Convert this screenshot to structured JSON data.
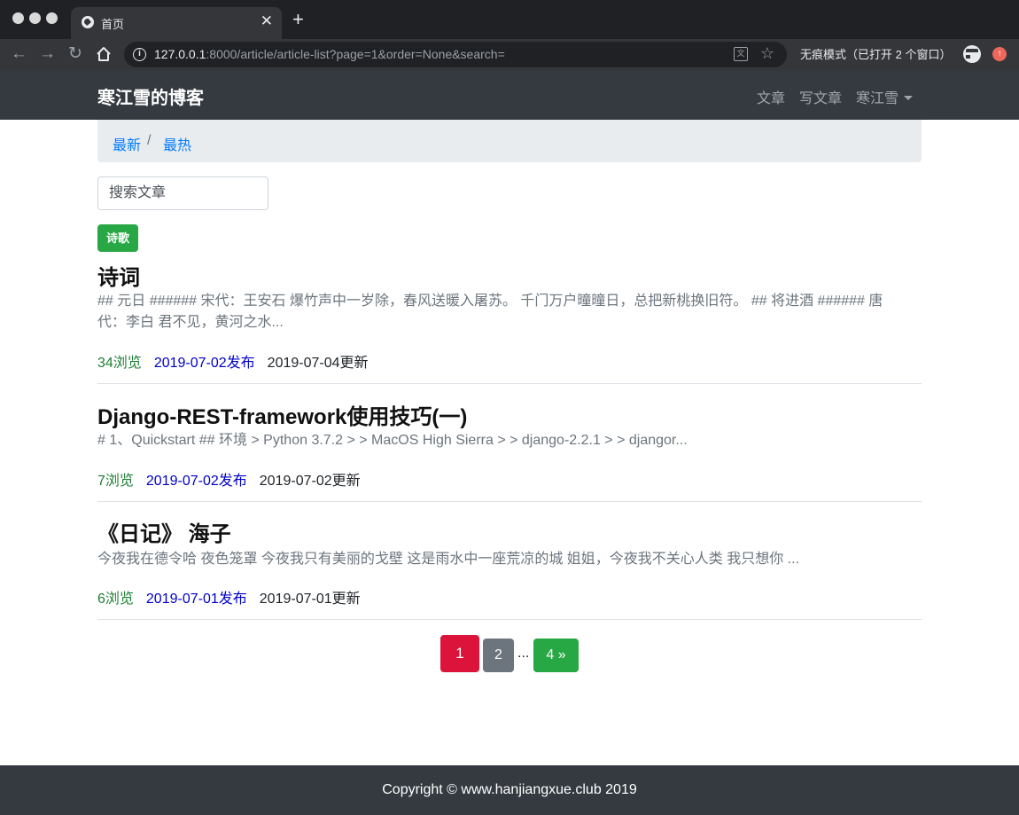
{
  "browser": {
    "tab_title": "首页",
    "tab_close": "✕",
    "new_tab": "+",
    "url_host": "127.0.0.1",
    "url_rest": ":8000/article/article-list?page=1&order=None&search=",
    "incognito_label": "无痕模式（已打开 2 个窗口）"
  },
  "navbar": {
    "brand": "寒江雪的博客",
    "links": [
      "文章",
      "写文章",
      "寒江雪"
    ]
  },
  "breadcrumb": {
    "items": [
      "最新",
      "最热"
    ],
    "separator": "/"
  },
  "search": {
    "placeholder": "搜索文章"
  },
  "tag": "诗歌",
  "articles": [
    {
      "title": "诗词",
      "excerpt": "## 元日 ###### 宋代：王安石 爆竹声中一岁除，春风送暖入屠苏。 千门万户曈曈日，总把新桃换旧符。 ## 将进酒 ###### 唐代：李白 君不见，黄河之水...",
      "views": "34浏览",
      "published": "2019-07-02发布",
      "updated": "2019-07-04更新"
    },
    {
      "title": "Django-REST-framework使用技巧(一)",
      "excerpt": "# 1、Quickstart ## 环境 > Python 3.7.2 > > MacOS High Sierra > > django-2.2.1 > > djangor...",
      "views": "7浏览",
      "published": "2019-07-02发布",
      "updated": "2019-07-02更新"
    },
    {
      "title": "《日记》 海子",
      "excerpt": "今夜我在德令哈 夜色笼罩 今夜我只有美丽的戈壁 这是雨水中一座荒凉的城 姐姐，今夜我不关心人类 我只想你 ...",
      "views": "6浏览",
      "published": "2019-07-01发布",
      "updated": "2019-07-01更新"
    }
  ],
  "pagination": {
    "current": "1",
    "next": "2",
    "ellipsis": "...",
    "last": "4 »"
  },
  "footer": "Copyright © www.hanjiangxue.club 2019",
  "colors": {
    "navbar_bg": "#343a40",
    "link_blue": "#007bff",
    "green": "#28a745",
    "current_page_red": "#dc143c",
    "page_gray": "#6c757d"
  }
}
